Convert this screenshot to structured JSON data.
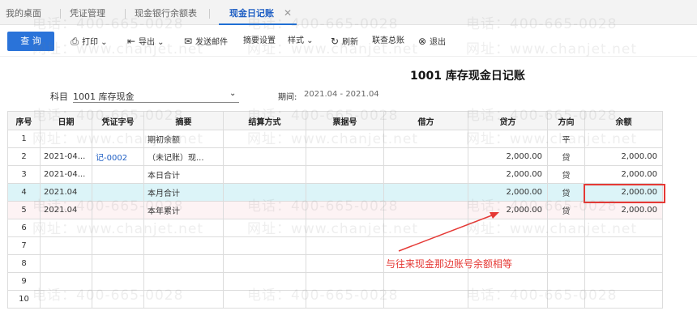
{
  "tabs": [
    {
      "label": "我的桌面"
    },
    {
      "label": "凭证管理"
    },
    {
      "label": "现金银行余额表"
    },
    {
      "label": "现金日记账"
    }
  ],
  "toolbar": {
    "query": "查 询",
    "print": "打印",
    "export": "导出",
    "email": "发送邮件",
    "summary_setting": "摘要设置",
    "style": "样式",
    "refresh": "刷新",
    "linked_ledger": "联查总账",
    "exit": "退出"
  },
  "report": {
    "title": "1001 库存现金日记账",
    "subject_label": "科目",
    "subject_value": "1001 库存现金",
    "period_label": "期间:",
    "period_value": "2021.04 - 2021.04"
  },
  "table": {
    "headers": [
      "序号",
      "日期",
      "凭证字号",
      "摘要",
      "结算方式",
      "票据号",
      "借方",
      "贷方",
      "方向",
      "余额"
    ],
    "rows": [
      [
        "1",
        "",
        "",
        "期初余额",
        "",
        "",
        "",
        "",
        "平",
        ""
      ],
      [
        "2",
        "2021-04...",
        "记-0002",
        "（未记账）现...",
        "",
        "",
        "",
        "2,000.00",
        "贷",
        "2,000.00"
      ],
      [
        "3",
        "2021-04...",
        "",
        "本日合计",
        "",
        "",
        "",
        "2,000.00",
        "贷",
        "2,000.00"
      ],
      [
        "4",
        "2021.04",
        "",
        "本月合计",
        "",
        "",
        "",
        "2,000.00",
        "贷",
        "2,000.00"
      ],
      [
        "5",
        "2021.04",
        "",
        "本年累计",
        "",
        "",
        "",
        "2,000.00",
        "贷",
        "2,000.00"
      ],
      [
        "6",
        "",
        "",
        "",
        "",
        "",
        "",
        "",
        "",
        ""
      ],
      [
        "7",
        "",
        "",
        "",
        "",
        "",
        "",
        "",
        "",
        ""
      ],
      [
        "8",
        "",
        "",
        "",
        "",
        "",
        "",
        "",
        "",
        ""
      ],
      [
        "9",
        "",
        "",
        "",
        "",
        "",
        "",
        "",
        "",
        ""
      ],
      [
        "10",
        "",
        "",
        "",
        "",
        "",
        "",
        "",
        "",
        ""
      ]
    ]
  },
  "annotation": "与往来现金那边账号余额相等",
  "watermark": {
    "phone": "电话：400-665-0028",
    "site": "网址：www.chanjet.net"
  },
  "colors": {
    "accent": "#2a73d9",
    "highlight_row": "#dcf4f8",
    "annotation_red": "#e53935"
  }
}
